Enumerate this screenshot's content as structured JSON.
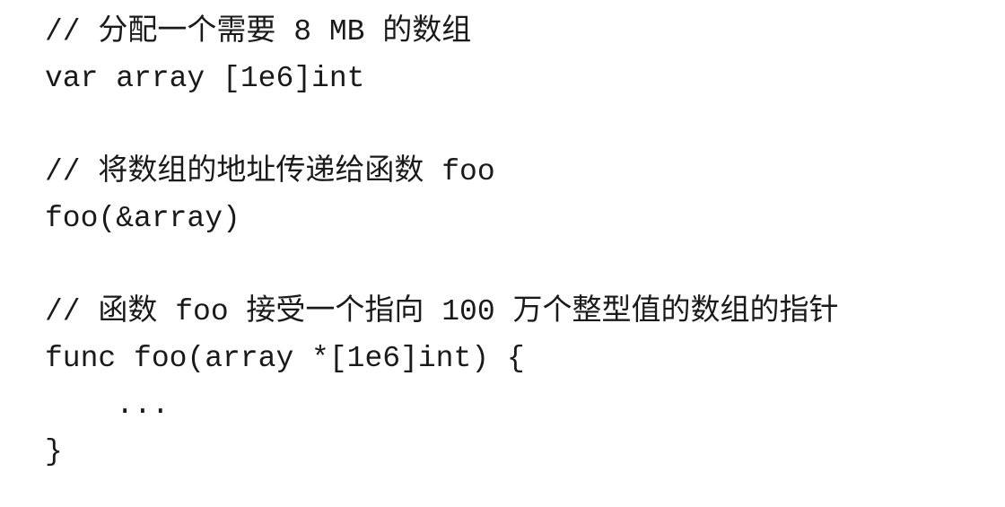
{
  "code": {
    "comment_1": "// 分配一个需要 8 MB 的数组",
    "line_1": "var array [1e6]int",
    "comment_2": "// 将数组的地址传递给函数 foo",
    "line_2": "foo(&array)",
    "comment_3": "// 函数 foo 接受一个指向 100 万个整型值的数组的指针",
    "line_3": "func foo(array *[1e6]int) {",
    "line_4": "    ...",
    "line_5": "}"
  }
}
